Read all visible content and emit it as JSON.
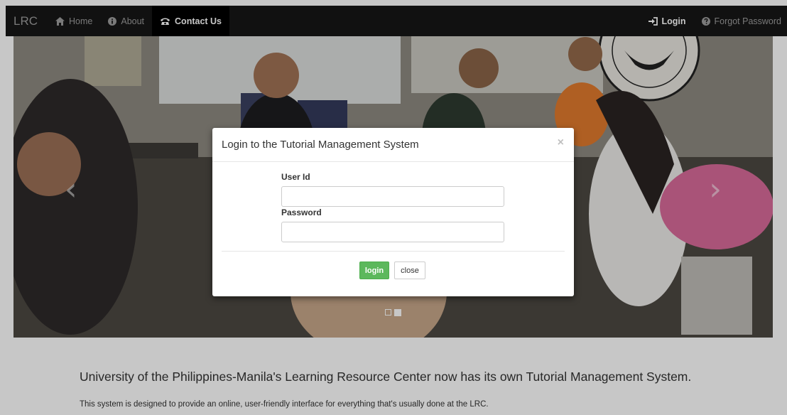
{
  "navbar": {
    "brand": "LRC",
    "items": [
      {
        "label": "Home",
        "icon": "home-icon"
      },
      {
        "label": "About",
        "icon": "info-circle-icon"
      },
      {
        "label": "Contact Us",
        "icon": "phone-icon",
        "active": true
      }
    ],
    "right_items": [
      {
        "label": "Login",
        "icon": "login-icon"
      },
      {
        "label": "Forgot Password",
        "icon": "question-circle-icon"
      }
    ]
  },
  "carousel": {
    "prev_arrow": "‹",
    "next_arrow": "›",
    "slide_count": 2,
    "active_slide": 2
  },
  "modal": {
    "title": "Login to the Tutorial Management System",
    "close_symbol": "×",
    "userid_label": "User Id",
    "userid_value": "",
    "password_label": "Password",
    "password_value": "",
    "login_button": "login",
    "close_button": "close"
  },
  "content": {
    "headline": "University of the Philippines-Manila's Learning Resource Center now has its own Tutorial Management System.",
    "description": "This system is designed to provide an online, user-friendly interface for everything that's usually done at the LRC."
  },
  "colors": {
    "navbar_bg": "#161616",
    "active_nav_bg": "#000000",
    "login_button": "#5cb85c",
    "text": "#333333"
  }
}
